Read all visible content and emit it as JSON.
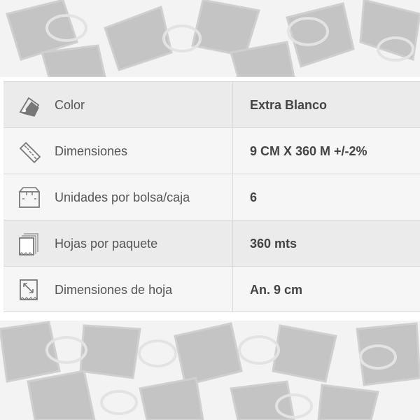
{
  "specs": [
    {
      "label": "Color",
      "value": "Extra Blanco",
      "icon": "color-swatch-icon"
    },
    {
      "label": "Dimensiones",
      "value": "9 CM X 360 M +/-2%",
      "icon": "ruler-icon"
    },
    {
      "label": "Unidades por bolsa/caja",
      "value": "6",
      "icon": "box-icon"
    },
    {
      "label": "Hojas por paquete",
      "value": "360 mts",
      "icon": "sheets-icon"
    },
    {
      "label": "Dimensiones de hoja",
      "value": "An. 9 cm",
      "icon": "resize-sheet-icon"
    }
  ],
  "colors": {
    "background_pattern": "#bdbdbd",
    "row_shaded": "#ebebeb",
    "row_plain": "#f6f6f6",
    "text_label": "#555555",
    "text_value": "#444444"
  }
}
